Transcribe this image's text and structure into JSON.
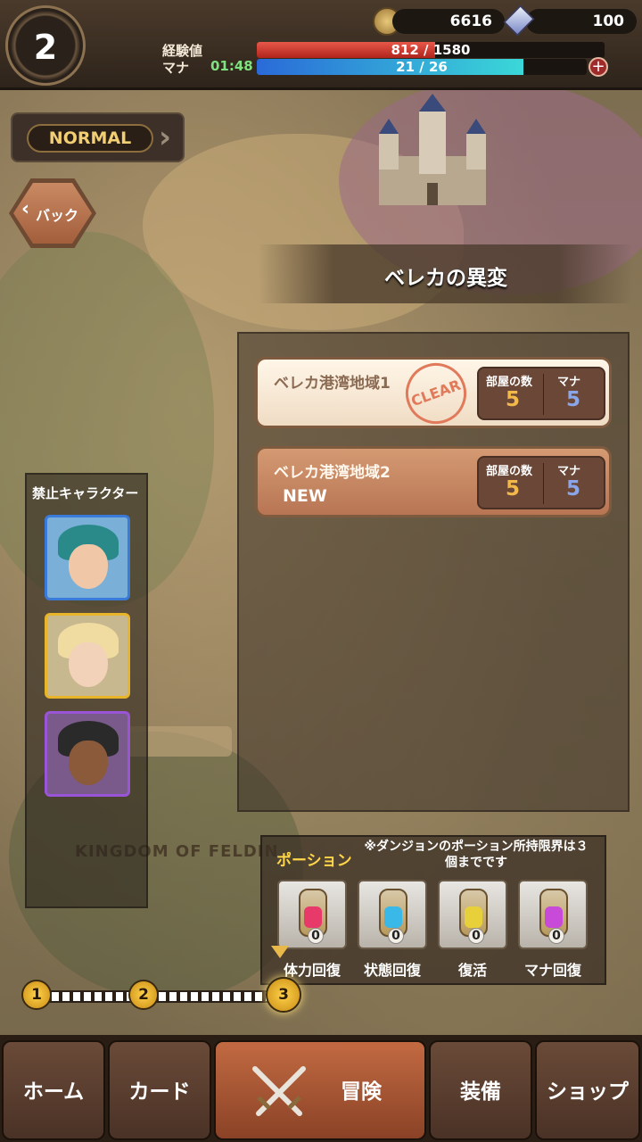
{
  "player": {
    "level": "2",
    "gold": "6616",
    "crystals": "100",
    "exp_label": "経験値",
    "exp_current": 812,
    "exp_max": 1580,
    "exp_text": "812  /  1580",
    "mana_label": "マナ",
    "mana_timer": "01:48",
    "mana_current": 21,
    "mana_max": 26,
    "mana_text": "21  /  26"
  },
  "difficulty": {
    "label": "NORMAL"
  },
  "back_button": {
    "label": "バック"
  },
  "chapter": {
    "title": "ベレカの異変"
  },
  "stages": [
    {
      "name": "ベレカ港湾地域1",
      "status": "CLEAR",
      "rooms_label": "部屋の数",
      "rooms": "5",
      "mana_label": "マナ",
      "mana": "5"
    },
    {
      "name": "ベレカ港湾地域2",
      "status": "NEW",
      "rooms_label": "部屋の数",
      "rooms": "5",
      "mana_label": "マナ",
      "mana": "5"
    }
  ],
  "banned": {
    "title": "禁止キャラクター",
    "characters": [
      {
        "frame_color": "#3a7ad8",
        "hair_color": "#2a8a8a",
        "bg": "#7ab0d8"
      },
      {
        "frame_color": "#e8b42a",
        "hair_color": "#f0dca0",
        "bg": "#c8b890"
      },
      {
        "frame_color": "#9a54d8",
        "hair_color": "#2a2a2a",
        "bg": "#7a5a8a"
      }
    ]
  },
  "potions": {
    "title": "ポーション",
    "note": "※ダンジョンのポーション所持限界は３個までです",
    "items": [
      {
        "label": "体力回復",
        "count": "0",
        "color": "#e83a6a"
      },
      {
        "label": "状態回復",
        "count": "0",
        "color": "#3ab8e8"
      },
      {
        "label": "復活",
        "count": "0",
        "color": "#e8d03a"
      },
      {
        "label": "マナ回復",
        "count": "0",
        "color": "#c84ad8"
      }
    ]
  },
  "map": {
    "region_label": "KINGDOM OF FELDIN"
  },
  "progress": {
    "steps": [
      "1",
      "2",
      "3"
    ],
    "current": 3
  },
  "nav": {
    "home": "ホーム",
    "card": "カード",
    "adventure": "冒険",
    "equipment": "装備",
    "shop": "ショップ",
    "active": "adventure"
  }
}
